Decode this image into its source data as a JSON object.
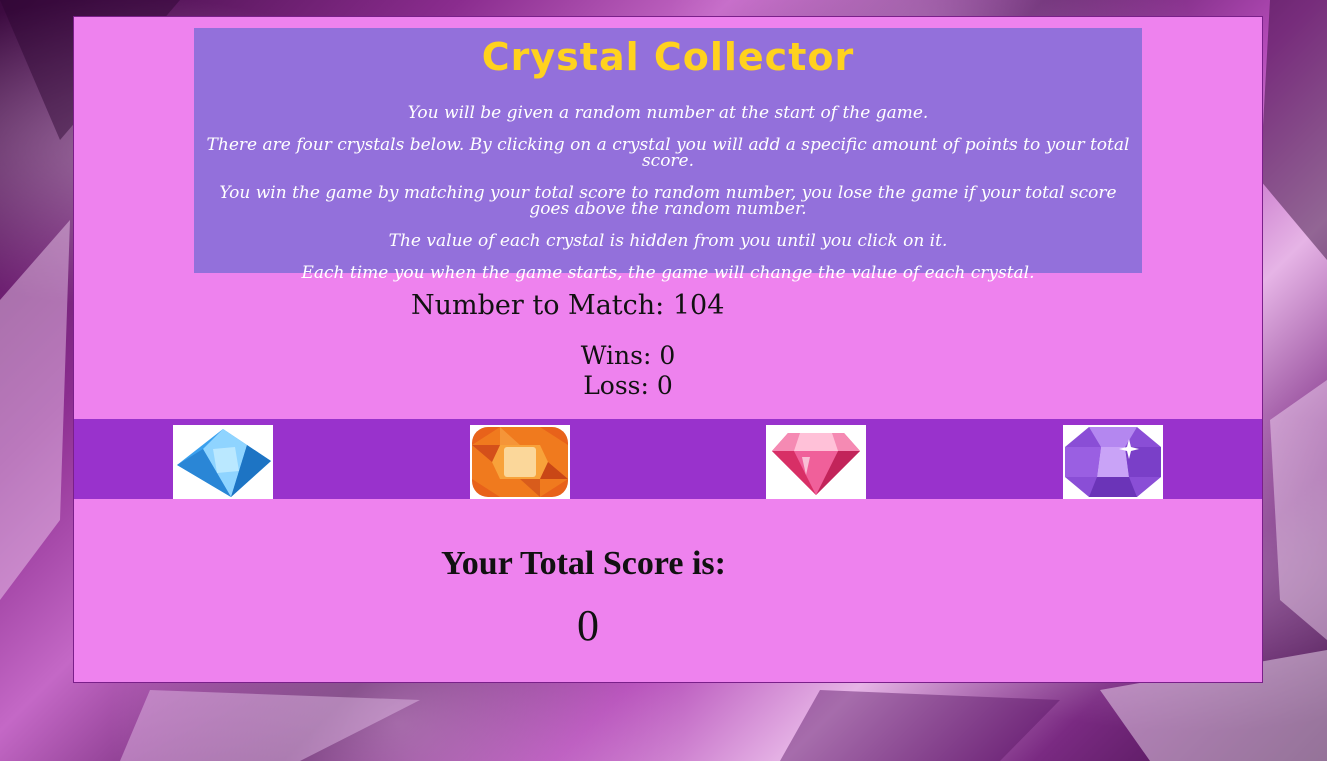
{
  "page": {
    "title": "Crystal Collector",
    "rules": [
      "You will be given a random number at the start of the game.",
      "There are four crystals below. By clicking on a crystal you will add a specific amount of points to your total score.",
      "You win the game by matching your total score to random number, you lose the game if your total score goes above the random number.",
      "The value of each crystal is hidden from you until you click on it.",
      "Each time you when the game starts, the game will change the value of each crystal."
    ]
  },
  "stats": {
    "match_label": "Number to Match:",
    "match_value": "104",
    "wins_label": "Wins:",
    "wins_value": "0",
    "loss_label": "Loss:",
    "loss_value": "0"
  },
  "crystals": [
    {
      "name": "blue-diamond-crystal-icon",
      "color": "#4fb3f5"
    },
    {
      "name": "orange-cushion-crystal-icon",
      "color": "#f07a1e"
    },
    {
      "name": "pink-gem-crystal-icon",
      "color": "#e8437a"
    },
    {
      "name": "purple-octagon-crystal-icon",
      "color": "#a05ee0"
    }
  ],
  "score": {
    "label": "Your Total Score is:",
    "value": "0"
  },
  "colors": {
    "panel": "#ee82ee",
    "intro_box": "#9370db",
    "title": "#ffd21e",
    "crystal_bar": "#9932cc"
  }
}
